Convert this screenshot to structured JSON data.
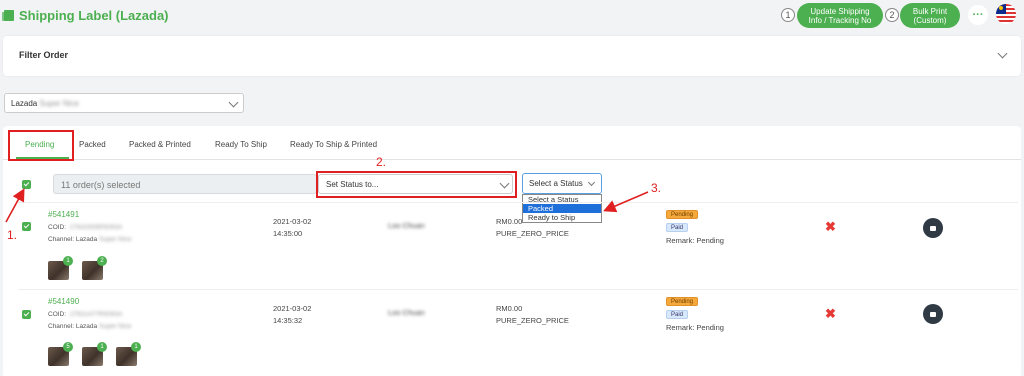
{
  "header": {
    "title": "Shipping Label (Lazada)",
    "step1": "1",
    "step2": "2",
    "update_btn_line1": "Update Shipping",
    "update_btn_line2": "Info / Tracking No",
    "bulk_btn_line1": "Bulk Print",
    "bulk_btn_line2": "(Custom)",
    "more_label": "···"
  },
  "filter": {
    "label": "Filter Order"
  },
  "store": {
    "prefix": "Lazada",
    "name": "Super Nice"
  },
  "tabs": [
    {
      "label": "Pending"
    },
    {
      "label": "Packed"
    },
    {
      "label": "Packed & Printed"
    },
    {
      "label": "Ready To Ship"
    },
    {
      "label": "Ready To Ship & Printed"
    }
  ],
  "toolbar": {
    "selected_text": "11 order(s) selected",
    "set_status_placeholder": "Set Status to...",
    "select_status_label": "Select a Status",
    "options": [
      "Select a Status",
      "Packed",
      "Ready to Ship"
    ]
  },
  "annotations": {
    "a1": "1.",
    "a2": "2.",
    "a3": "3."
  },
  "orders": [
    {
      "order_no": "#541491",
      "coid_label": "COID:",
      "coid": "27632505R5093A",
      "channel_label": "Channel: Lazada",
      "channel_store": "Super Nice",
      "date": "2021-03-02",
      "time": "14:35:00",
      "customer": "Loo Chuan",
      "amount": "RM0.00",
      "price_tag": "PURE_ZERO_PRICE",
      "status_badge": "Pending",
      "pay_badge": "Paid",
      "remark": "Remark: Pending",
      "items": [
        "1",
        "2"
      ]
    },
    {
      "order_no": "#541490",
      "coid_label": "COID:",
      "coid": "27631477R5093A",
      "channel_label": "Channel: Lazada",
      "channel_store": "Super Nice",
      "date": "2021-03-02",
      "time": "14:35:32",
      "customer": "Loo Chuan",
      "amount": "RM0.00",
      "price_tag": "PURE_ZERO_PRICE",
      "status_badge": "Pending",
      "pay_badge": "Paid",
      "remark": "Remark: Pending",
      "items": [
        "5",
        "1",
        "1"
      ]
    }
  ],
  "colors": {
    "accent": "#4caf50",
    "annotation": "#e02020",
    "highlight": "#1e6fd9"
  }
}
